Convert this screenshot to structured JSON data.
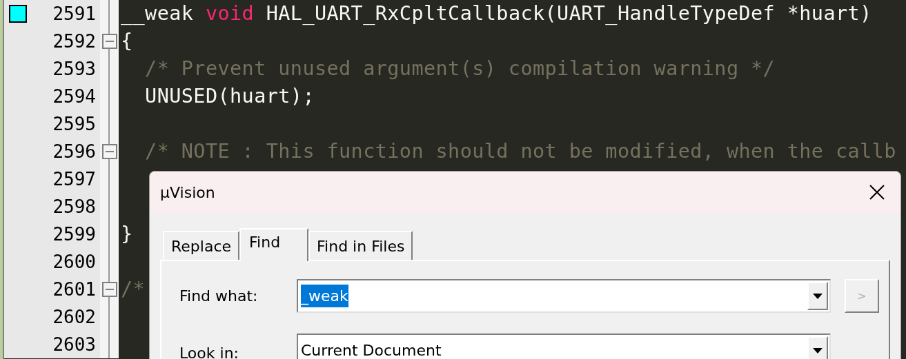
{
  "editor": {
    "lines": [
      {
        "number": "2591",
        "bookmark": true,
        "fold": false,
        "tokens": [
          {
            "kind": "plain",
            "text": "__weak "
          },
          {
            "kind": "keyword",
            "text": "void"
          },
          {
            "kind": "plain",
            "text": " HAL_UART_RxCpltCallback(UART_HandleTypeDef *huart)"
          }
        ]
      },
      {
        "number": "2592",
        "bookmark": false,
        "fold": true,
        "tokens": [
          {
            "kind": "plain",
            "text": "{"
          }
        ]
      },
      {
        "number": "2593",
        "bookmark": false,
        "fold": false,
        "tokens": [
          {
            "kind": "comment",
            "text": "  /* Prevent unused argument(s) compilation warning */"
          }
        ]
      },
      {
        "number": "2594",
        "bookmark": false,
        "fold": false,
        "tokens": [
          {
            "kind": "plain",
            "text": "  UNUSED(huart);"
          }
        ]
      },
      {
        "number": "2595",
        "bookmark": false,
        "fold": false
      },
      {
        "number": "2596",
        "bookmark": false,
        "fold": true,
        "tokens": [
          {
            "kind": "comment",
            "text": "  /* NOTE : This function should not be modified, when the callb"
          }
        ]
      },
      {
        "number": "2597",
        "bookmark": false,
        "fold": false
      },
      {
        "number": "2598",
        "bookmark": false,
        "fold": false
      },
      {
        "number": "2599",
        "bookmark": false,
        "fold": false,
        "tokens": [
          {
            "kind": "plain",
            "text": "}"
          }
        ]
      },
      {
        "number": "2600",
        "bookmark": false,
        "fold": false
      },
      {
        "number": "2601",
        "bookmark": false,
        "fold": true,
        "tokens": [
          {
            "kind": "comment",
            "text": "/*"
          }
        ]
      },
      {
        "number": "2602",
        "bookmark": false,
        "fold": false
      },
      {
        "number": "2603",
        "bookmark": false,
        "fold": false
      }
    ]
  },
  "dialog": {
    "title": "µVision",
    "tabs": [
      {
        "label": "Replace",
        "selected": false
      },
      {
        "label": "Find",
        "selected": true
      },
      {
        "label": "Find in Files",
        "selected": false
      }
    ],
    "find_what": {
      "label": "Find what:",
      "value": "_weak",
      "selected_text": true
    },
    "next_button": {
      "label": ">",
      "disabled": true
    },
    "look_in": {
      "label": "Look in:",
      "value": "Current Document"
    }
  }
}
